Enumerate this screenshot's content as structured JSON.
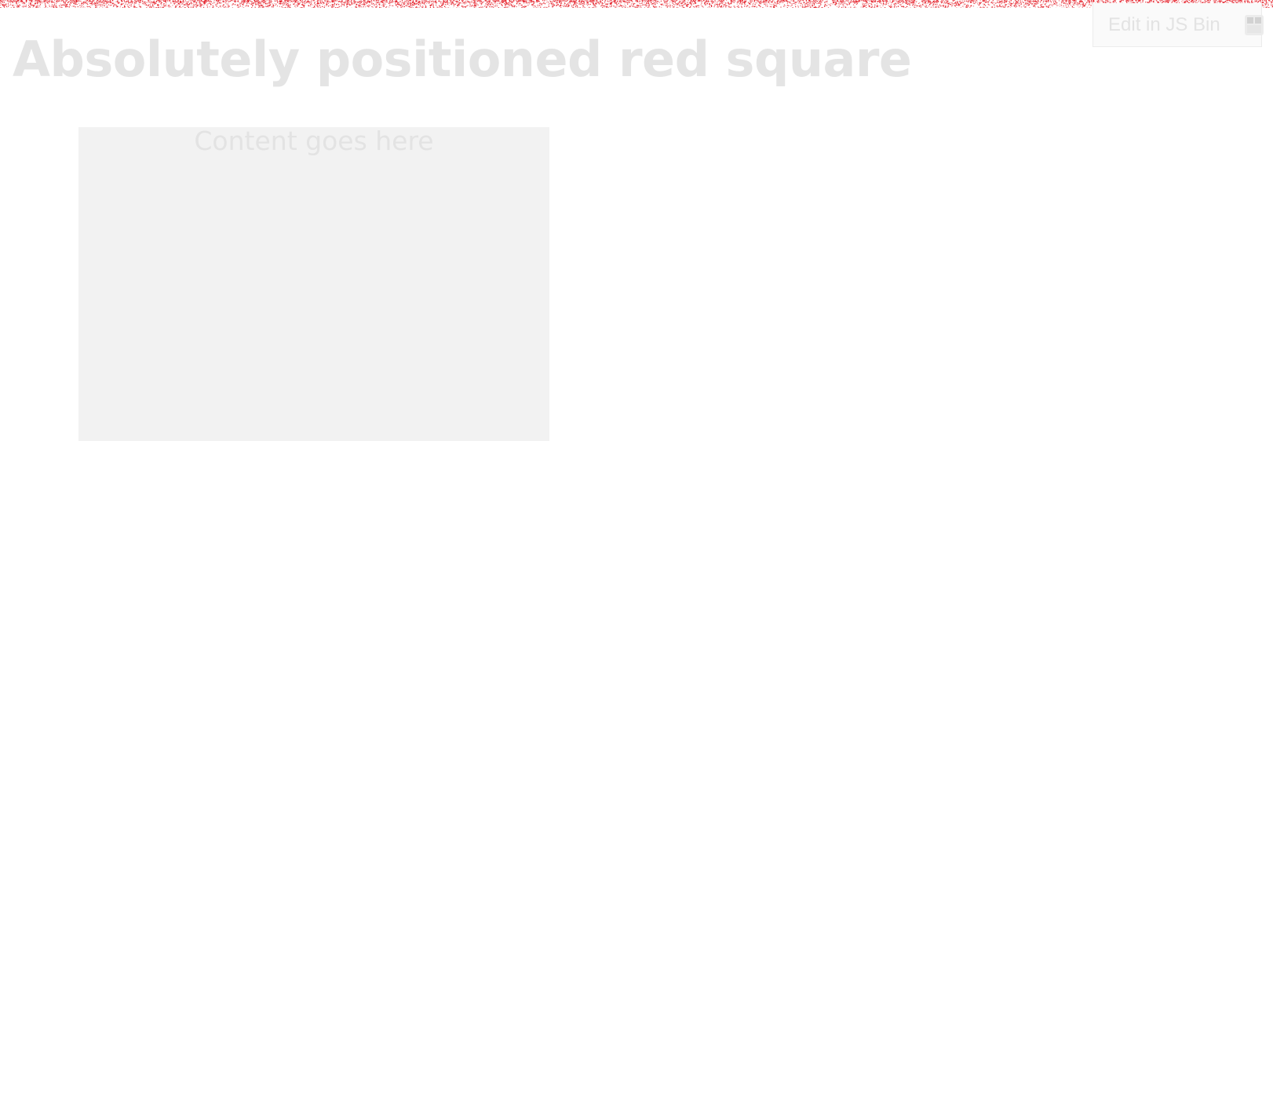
{
  "page": {
    "title": "Absolutely positioned red square"
  },
  "content_box": {
    "text": "Content goes here"
  },
  "edit_link": {
    "label": "Edit in JS Bin",
    "icon": "jsbin-icon"
  },
  "colors": {
    "accent_noise": "#e3121c",
    "title": "#e4e4e4",
    "box_background": "#f2f2f2"
  }
}
